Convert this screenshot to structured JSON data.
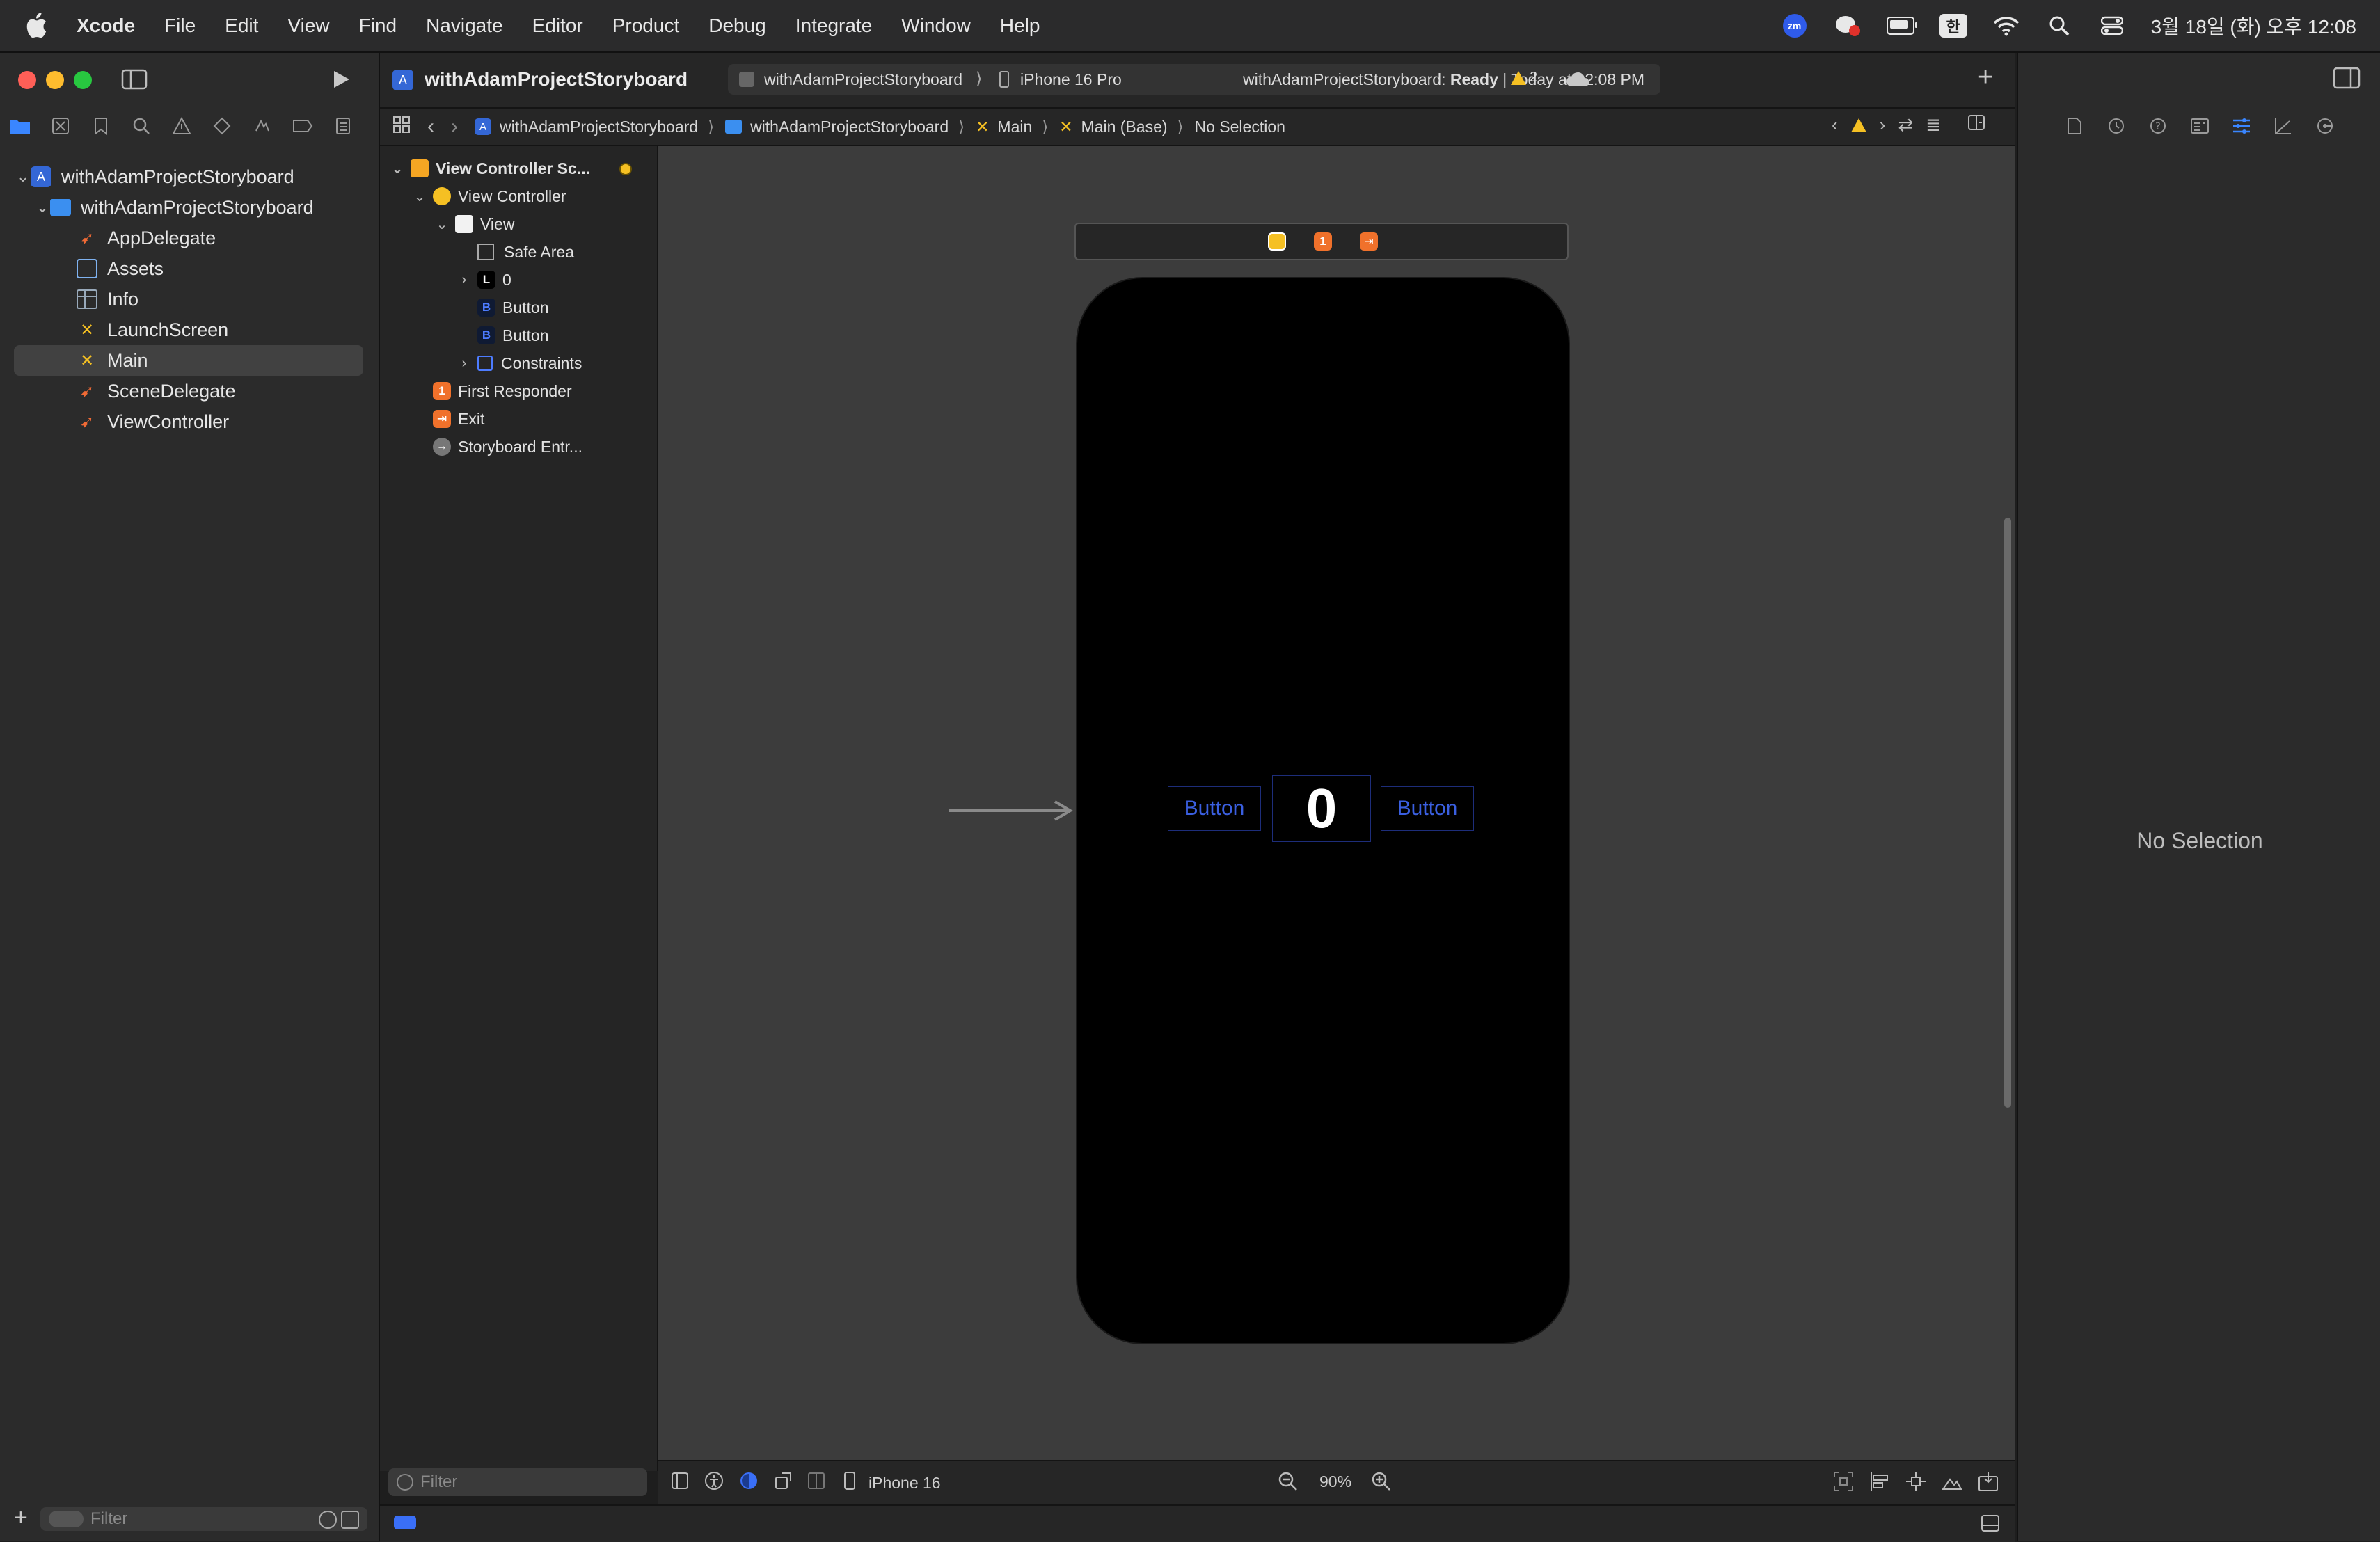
{
  "menubar": {
    "app_name": "Xcode",
    "items": [
      "File",
      "Edit",
      "View",
      "Find",
      "Navigate",
      "Editor",
      "Product",
      "Debug",
      "Integrate",
      "Window",
      "Help"
    ],
    "status_icons": [
      "zoom-icon",
      "chat-icon",
      "battery-icon",
      "input-method",
      "wifi-icon",
      "search-icon",
      "control-center-icon"
    ],
    "zoom_badge": "zm",
    "input_method": "한",
    "clock": "3월 18일 (화) 오후 12:08"
  },
  "toolbar": {
    "project_title": "withAdamProjectStoryboard",
    "scheme": "withAdamProjectStoryboard",
    "destination": "iPhone 16 Pro",
    "status_project": "withAdamProjectStoryboard:",
    "status_state": "Ready",
    "status_time": "| Today at 12:08 PM",
    "warning_count": "2"
  },
  "navigator": {
    "tabs": [
      "folder-icon",
      "source-control-icon",
      "bookmark-icon",
      "find-icon",
      "issue-icon",
      "test-icon",
      "debug-icon",
      "breakpoint-icon",
      "report-icon"
    ],
    "tree": [
      {
        "label": "withAdamProjectStoryboard",
        "kind": "project"
      },
      {
        "label": "withAdamProjectStoryboard",
        "kind": "folder"
      },
      {
        "label": "AppDelegate",
        "kind": "swift"
      },
      {
        "label": "Assets",
        "kind": "assets"
      },
      {
        "label": "Info",
        "kind": "plist"
      },
      {
        "label": "LaunchScreen",
        "kind": "storyboard"
      },
      {
        "label": "Main",
        "kind": "storyboard"
      },
      {
        "label": "SceneDelegate",
        "kind": "swift"
      },
      {
        "label": "ViewController",
        "kind": "swift"
      }
    ],
    "filter_placeholder": "Filter"
  },
  "breadcrumbs": [
    "withAdamProjectStoryboard",
    "withAdamProjectStoryboard",
    "Main",
    "Main (Base)",
    "No Selection"
  ],
  "outline": {
    "rows": [
      {
        "label": "View Controller Sc..."
      },
      {
        "label": "View Controller"
      },
      {
        "label": "View"
      },
      {
        "label": "Safe Area"
      },
      {
        "label": "0",
        "badge": "L"
      },
      {
        "label": "Button",
        "badge": "B"
      },
      {
        "label": "Button",
        "badge": "B"
      },
      {
        "label": "Constraints"
      },
      {
        "label": "First Responder",
        "badge": "1"
      },
      {
        "label": "Exit"
      },
      {
        "label": "Storyboard Entr..."
      }
    ],
    "filter_placeholder": "Filter"
  },
  "canvas": {
    "dock_badge": "1",
    "left_button": "Button",
    "count_label": "0",
    "right_button": "Button"
  },
  "canvas_bottom": {
    "device": "iPhone 16",
    "zoom": "90%"
  },
  "inspector": {
    "empty_text": "No Selection"
  },
  "colors": {
    "accent": "#3a86ff",
    "storyboard_button": "#3a5fe0",
    "warning": "#f5c023",
    "swift": "#f06a35"
  }
}
